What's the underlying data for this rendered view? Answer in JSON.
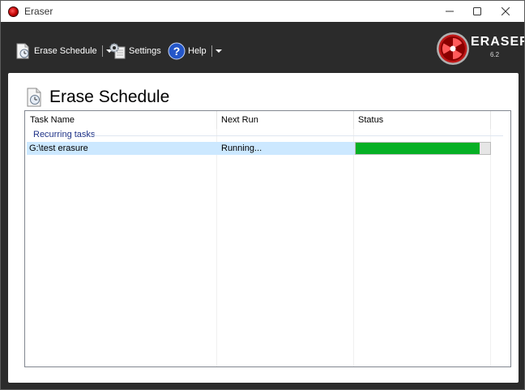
{
  "window": {
    "title": "Eraser",
    "controls": {
      "minimize": "minimize",
      "maximize": "maximize",
      "close": "close"
    }
  },
  "toolbar": {
    "erase_schedule_label": "Erase Schedule",
    "settings_label": "Settings",
    "help_label": "Help",
    "brand_name": "ERASER",
    "version": "6.2"
  },
  "main": {
    "heading": "Erase Schedule",
    "columns": [
      "Task Name",
      "Next Run",
      "Status"
    ],
    "groups": [
      {
        "label": "Recurring tasks",
        "tasks": [
          {
            "name": "G:\\test erasure",
            "next_run": "Running...",
            "progress_fraction": 0.92
          }
        ]
      }
    ]
  },
  "colors": {
    "progress_fill": "#06b025",
    "selected_row": "#cce8ff",
    "group_label": "#1e3287",
    "toolbar_bg": "#2b2b2b"
  },
  "icons": [
    "eraser-app-icon",
    "erase-schedule-icon",
    "settings-gear-icon",
    "help-icon",
    "eraser-logo-icon"
  ]
}
